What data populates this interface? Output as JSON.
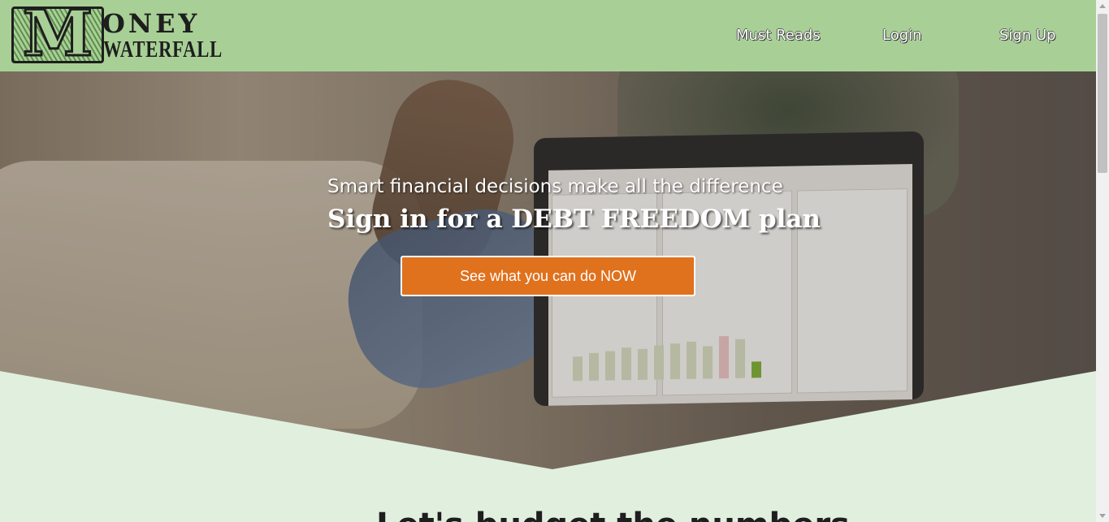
{
  "header": {
    "logo": {
      "letter": "M",
      "line1": "ONEY",
      "line2": "WATERFALL"
    },
    "nav": [
      {
        "label": "Must Reads"
      },
      {
        "label": "Login"
      },
      {
        "label": "Sign Up"
      }
    ]
  },
  "hero": {
    "tagline": "Smart financial decisions make all the difference",
    "headline": "Sign in for a DEBT FREEDOM plan",
    "cta_label": "See what you can do NOW"
  },
  "section": {
    "heading": "Let's budget the numbers"
  },
  "colors": {
    "header_bg": "#a8d096",
    "page_bg": "#e1efdf",
    "cta_bg": "#e0711d"
  }
}
